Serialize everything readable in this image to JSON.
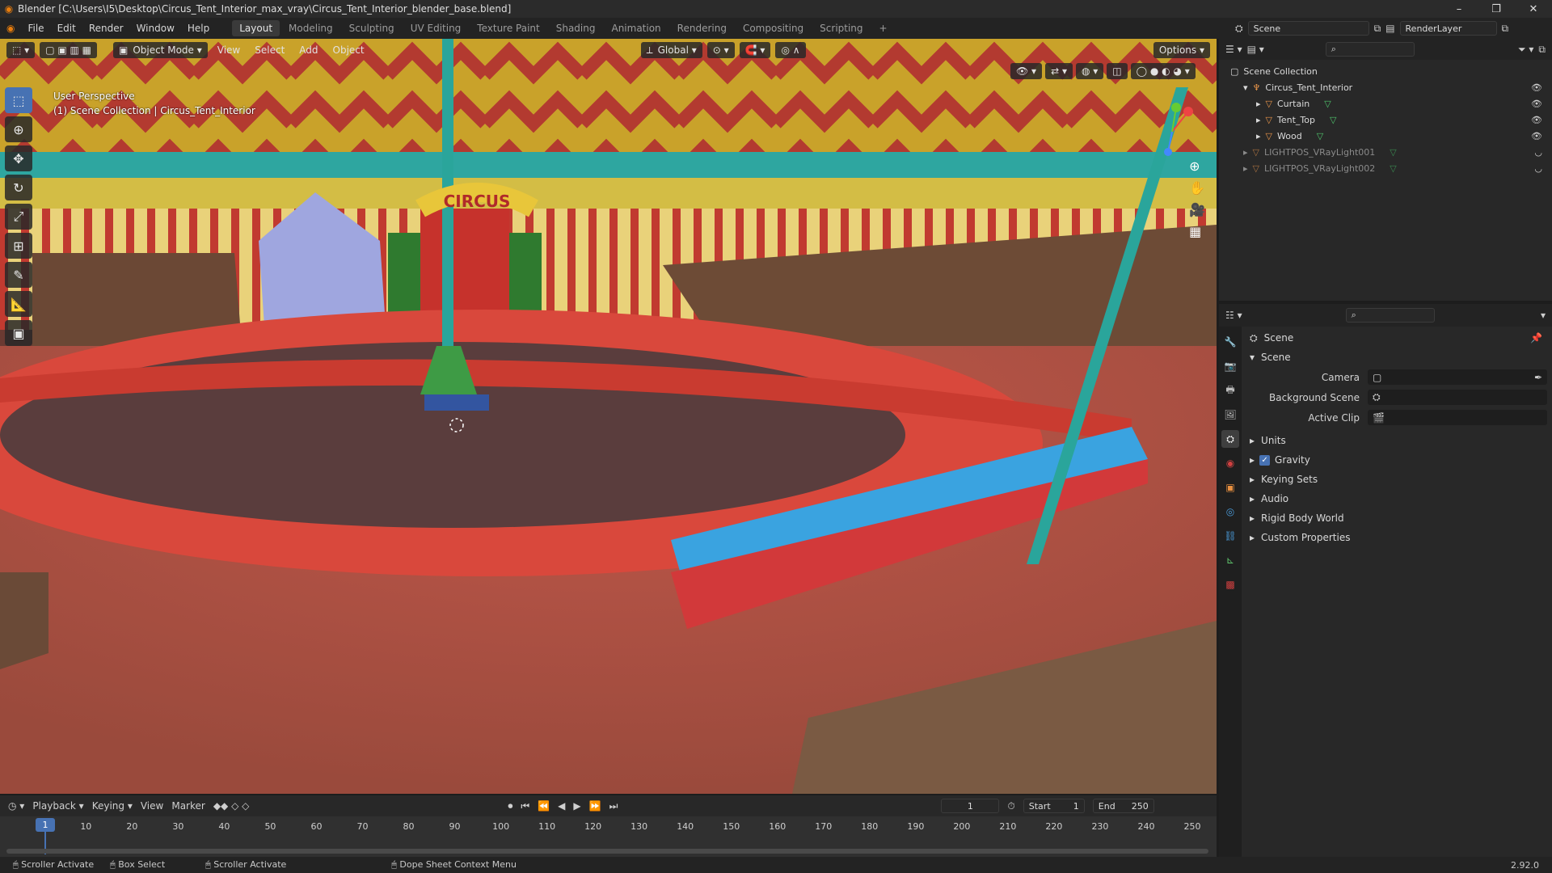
{
  "window": {
    "title": "Blender [C:\\Users\\I5\\Desktop\\Circus_Tent_Interior_max_vray\\Circus_Tent_Interior_blender_base.blend]",
    "controls": [
      "–",
      "❐",
      "✕"
    ]
  },
  "menubar": {
    "items": [
      "File",
      "Edit",
      "Render",
      "Window",
      "Help"
    ],
    "workspaces": [
      "Layout",
      "Modeling",
      "Sculpting",
      "UV Editing",
      "Texture Paint",
      "Shading",
      "Animation",
      "Rendering",
      "Compositing",
      "Scripting"
    ],
    "active_workspace": "Layout",
    "add_tab": "+",
    "scene_name": "Scene",
    "view_layer": "RenderLayer"
  },
  "viewport": {
    "mode": "Object Mode",
    "menus": [
      "View",
      "Select",
      "Add",
      "Object"
    ],
    "transform_orientation": "Global",
    "options_label": "Options",
    "overlay_line1": "User Perspective",
    "overlay_line2": "(1) Scene Collection | Circus_Tent_Interior",
    "sign_text": "CIRCUS",
    "tools": [
      "select-box-icon",
      "cursor-icon",
      "move-icon",
      "rotate-icon",
      "scale-icon",
      "transform-icon",
      "annotate-icon",
      "measure-icon",
      "add-cube-icon"
    ]
  },
  "outliner": {
    "root": "Scene Collection",
    "rows": [
      {
        "label": "Circus_Tent_Interior",
        "depth": 1,
        "expanded": true,
        "visible": true
      },
      {
        "label": "Curtain",
        "depth": 2,
        "expanded": false,
        "visible": true
      },
      {
        "label": "Tent_Top",
        "depth": 2,
        "expanded": false,
        "visible": true
      },
      {
        "label": "Wood",
        "depth": 2,
        "expanded": false,
        "visible": true
      },
      {
        "label": "LIGHTPOS_VRayLight001",
        "depth": 1,
        "expanded": false,
        "visible": false
      },
      {
        "label": "LIGHTPOS_VRayLight002",
        "depth": 1,
        "expanded": false,
        "visible": false
      }
    ]
  },
  "properties": {
    "breadcrumb": "Scene",
    "section": "Scene",
    "camera_label": "Camera",
    "background_scene_label": "Background Scene",
    "active_clip_label": "Active Clip",
    "panels": [
      "Units",
      "Gravity",
      "Keying Sets",
      "Audio",
      "Rigid Body World",
      "Custom Properties"
    ],
    "gravity_checked": true
  },
  "timeline": {
    "menus": [
      "Playback",
      "Keying",
      "View",
      "Marker"
    ],
    "current_frame": "1",
    "start_label": "Start",
    "start": "1",
    "end_label": "End",
    "end": "250",
    "ruler": [
      "1",
      "10",
      "20",
      "30",
      "40",
      "50",
      "60",
      "70",
      "80",
      "90",
      "100",
      "110",
      "120",
      "130",
      "140",
      "150",
      "160",
      "170",
      "180",
      "190",
      "200",
      "210",
      "220",
      "230",
      "240",
      "250"
    ]
  },
  "statusbar": {
    "items": [
      "Scroller Activate",
      "Box Select",
      "Scroller Activate",
      "Dope Sheet Context Menu"
    ],
    "version": "2.92.0"
  }
}
